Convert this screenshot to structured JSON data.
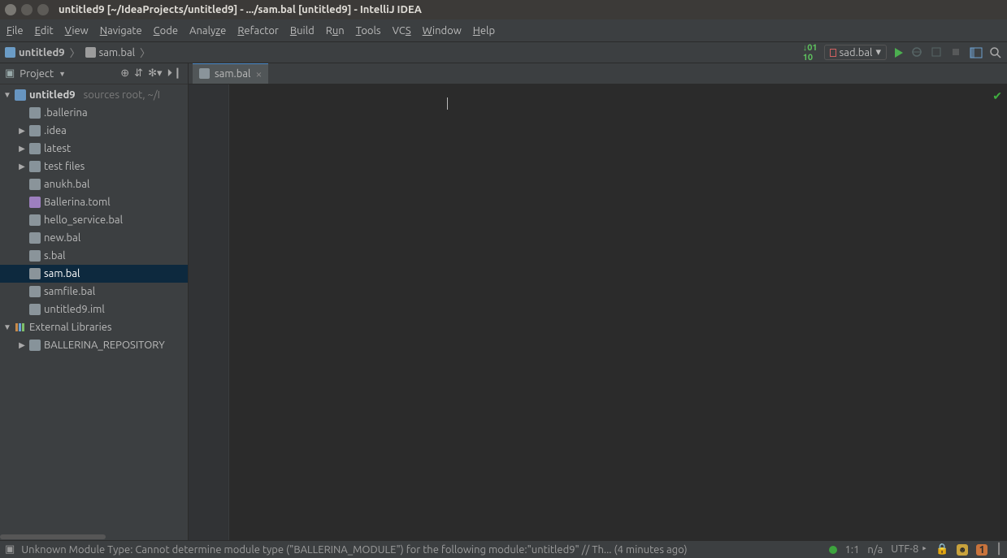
{
  "window": {
    "title": "untitled9 [~/IdeaProjects/untitled9] - .../sam.bal [untitled9] - IntelliJ IDEA"
  },
  "menu": [
    "File",
    "Edit",
    "View",
    "Navigate",
    "Code",
    "Analyze",
    "Refactor",
    "Build",
    "Run",
    "Tools",
    "VCS",
    "Window",
    "Help"
  ],
  "breadcrumb": {
    "project": "untitled9",
    "file": "sam.bal"
  },
  "toolbar": {
    "diff_label": "01\n10",
    "run_config": "sad.bal",
    "run_config_suffix": "▾"
  },
  "project_view": {
    "title": "Project",
    "root": {
      "label": "untitled9",
      "hint": "sources root,  ~/I"
    },
    "items": [
      {
        "indent": 1,
        "icon": "folder",
        "label": ".ballerina",
        "expand": "none"
      },
      {
        "indent": 1,
        "icon": "folder",
        "label": ".idea",
        "expand": "closed"
      },
      {
        "indent": 1,
        "icon": "folder",
        "label": "latest",
        "expand": "closed"
      },
      {
        "indent": 1,
        "icon": "folder",
        "label": "test files",
        "expand": "closed"
      },
      {
        "indent": 1,
        "icon": "file",
        "label": "anukh.bal",
        "expand": "none"
      },
      {
        "indent": 1,
        "icon": "bal",
        "label": "Ballerina.toml",
        "expand": "none"
      },
      {
        "indent": 1,
        "icon": "file",
        "label": "hello_service.bal",
        "expand": "none"
      },
      {
        "indent": 1,
        "icon": "file",
        "label": "new.bal",
        "expand": "none"
      },
      {
        "indent": 1,
        "icon": "file",
        "label": "s.bal",
        "expand": "none"
      },
      {
        "indent": 1,
        "icon": "file",
        "label": "sam.bal",
        "expand": "none",
        "selected": true
      },
      {
        "indent": 1,
        "icon": "file",
        "label": "samfile.bal",
        "expand": "none"
      },
      {
        "indent": 1,
        "icon": "file",
        "label": "untitled9.iml",
        "expand": "none"
      }
    ],
    "external_libs": {
      "label": "External Libraries",
      "children": [
        {
          "label": "BALLERINA_REPOSITORY"
        }
      ]
    }
  },
  "editor": {
    "tab_label": "sam.bal"
  },
  "status": {
    "message": "Unknown Module Type: Cannot determine module type (\"BALLERINA_MODULE\") for the following module:\"untitled9\" // Th... (4 minutes ago)",
    "position": "1:1",
    "insp": "n/a",
    "encoding": "UTF-8",
    "encoding_suffix": "‣",
    "lock": "🔒",
    "badge1": "1"
  }
}
